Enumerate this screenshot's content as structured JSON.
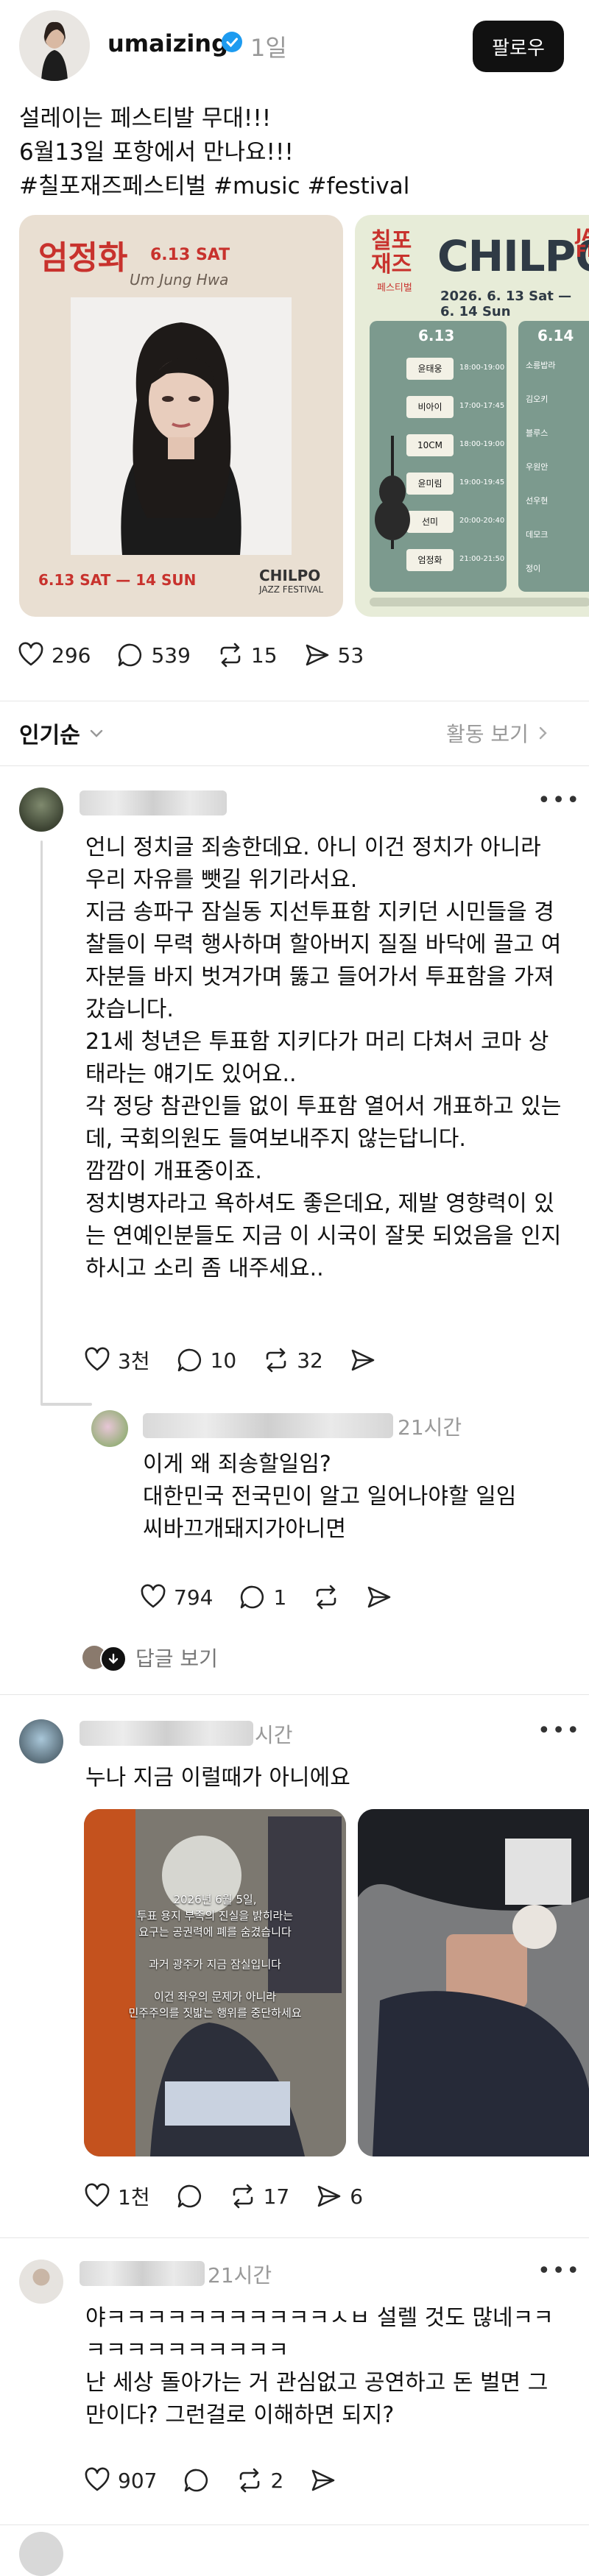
{
  "post": {
    "username": "umaizing",
    "time": "1일",
    "follow_label": "팔로우",
    "text": "설레이는 페스티발 무대!!!\n6월13일 포항에서 만나요!!!\n#칠포재즈페스티벌 #music #festival",
    "poster1": {
      "artist": "엄정화",
      "date": "6.13 SAT",
      "signature": "Um Jung Hwa",
      "footer_date": "6.13 SAT — 14 SUN",
      "logo": "CHILPO",
      "logo_sub": "JAZZ FESTIVAL"
    },
    "poster2": {
      "logo_kr": "칠포 재즈",
      "logo_kr_sub": "페스티벌",
      "logo": "CHILPO",
      "logo_suffix": "JAZZ FES",
      "dates": "2026. 6. 13 Sat — 6. 14 Sun",
      "day1": "6.13",
      "day2": "6.14",
      "lineup": [
        {
          "name": "윤태웅",
          "time": "18:00-19:00"
        },
        {
          "name": "비아이",
          "time": "17:00-17:45"
        },
        {
          "name": "10CM",
          "time": "18:00-19:00"
        },
        {
          "name": "윤미림",
          "time": "19:00-19:45"
        },
        {
          "name": "선미",
          "time": "20:00-20:40"
        },
        {
          "name": "엄정화",
          "time": "21:00-21:50"
        }
      ],
      "lineup2": [
        "소릉밥라",
        "김오키",
        "블루스",
        "우원안",
        "선우현",
        "데모크",
        "정이"
      ]
    },
    "likes": "296",
    "comments": "539",
    "reposts": "15",
    "shares": "53"
  },
  "sort": {
    "label": "인기순",
    "activity_label": "활동 보기"
  },
  "replies": [
    {
      "text": "언니 정치글 죄송한데요. 아니 이건 정치가 아니라 우리 자유를 뺏길 위기라서요.\n지금 송파구 잠실동 지선투표함 지키던 시민들을 경찰들이 무력 행사하며 할아버지 질질 바닥에 끌고 여자분들 바지 벗겨가며 뚫고 들어가서 투표함을 가져갔습니다.\n21세 청년은 투표함 지키다가 머리 다쳐서 코마 상태라는 얘기도 있어요..\n각 정당 참관인들 없이 투표함 열어서 개표하고 있는데, 국회의원도 들여보내주지 않는답니다.\n깜깜이 개표중이죠.\n정치병자라고 욕하셔도 좋은데요, 제발 영향력이 있는 연예인분들도 지금 이 시국이 잘못 되었음을 인지하시고 소리 좀 내주세요..",
      "likes": "3천",
      "comments": "10",
      "reposts": "32"
    },
    {
      "time_fragment": "21시간",
      "text": "이게 왜 죄송할일임?\n대한민국 전국민이 알고 일어나야할 일임\n씨바끄개돼지가아니면",
      "likes": "794",
      "comments": "1",
      "view_replies_label": "답글 보기"
    },
    {
      "time_fragment": "시간",
      "text": "누나 지금 이럴때가 아니에요",
      "photo_caption": "2026년 6월 5일,\n투표 용지 부족의 진실을 밝히라는\n요구는 공권력에 폐를 숨겼습니다\n\n과거 광주가 지금 잠실입니다\n\n이건 좌우의 문제가 아니라\n민주주의를 짓밟는 행위를 중단하세요",
      "likes": "1천",
      "reposts": "17",
      "shares": "6"
    },
    {
      "time_fragment": "21시간",
      "text": "야ㅋㅋㅋㅋㅋㅋㅋㅋㅋㅋㅋㅅㅂ 설렐 것도 많네ㅋㅋ\nㅋㅋㅋㅋㅋㅋㅋㅋㅋㅋ\n난 세상 돌아가는 거 관심없고 공연하고 돈 벌면 그만이다? 그런걸로 이해하면 되지?",
      "likes": "907",
      "reposts": "2"
    }
  ],
  "colors": {
    "verified": "#1d9bf0",
    "poster1_bg": "#e9dfd2",
    "poster1_red": "#c8322d",
    "poster2_bg": "#e7ecd8",
    "poster2_panel": "#7c9a8e"
  }
}
